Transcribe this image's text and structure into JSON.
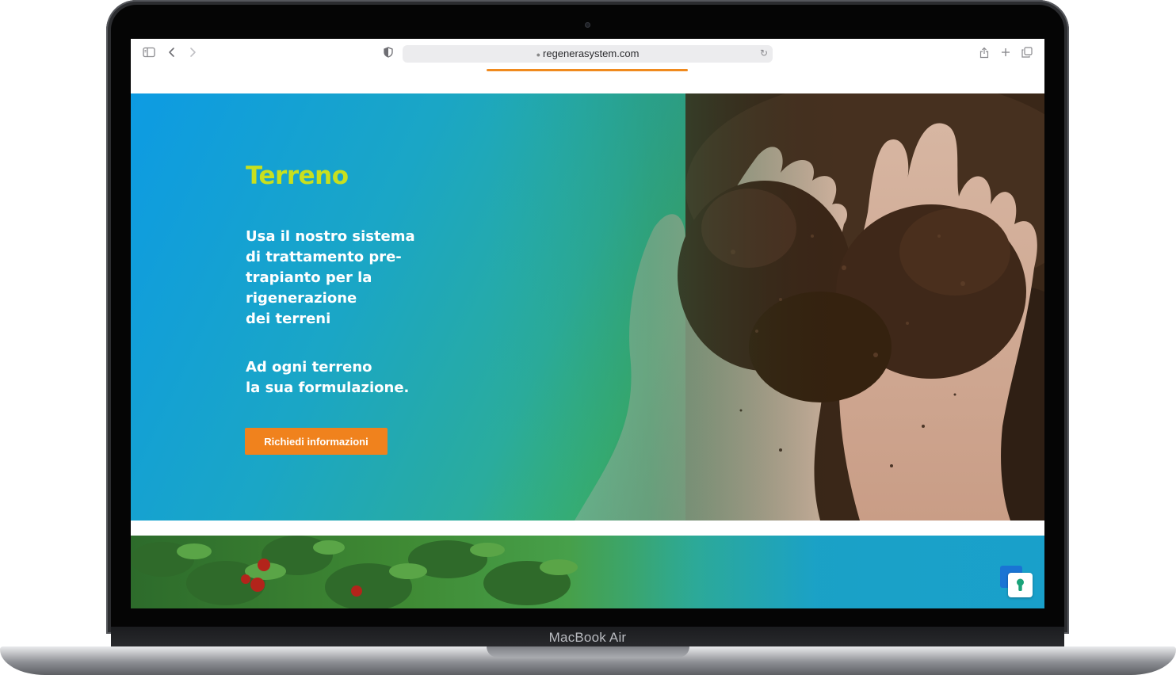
{
  "device": {
    "label": "MacBook Air"
  },
  "browser": {
    "url": "regenerasystem.com"
  },
  "hero": {
    "title": "Terreno",
    "lead": "Usa il nostro sistema\ndi trattamento pre-\ntrapianto per la\nrigenerazione\ndei terreni",
    "sub": "Ad ogni terreno\nla sua formulazione.",
    "cta_label": "Richiedi informazioni"
  },
  "icons": {
    "sidebar": "sidebar-icon",
    "back": "chevron-left-icon",
    "forward": "chevron-right-icon",
    "shield": "shield-icon",
    "reload": "reload-icon",
    "share": "share-icon",
    "new_tab": "plus-icon",
    "tabs": "tabs-icon",
    "cookie_badge": "keyhole-icon"
  },
  "colors": {
    "title": "#c8e01e",
    "accent": "#f0821d",
    "gradient_blue": "#0d9be3",
    "gradient_green": "#38b173"
  }
}
